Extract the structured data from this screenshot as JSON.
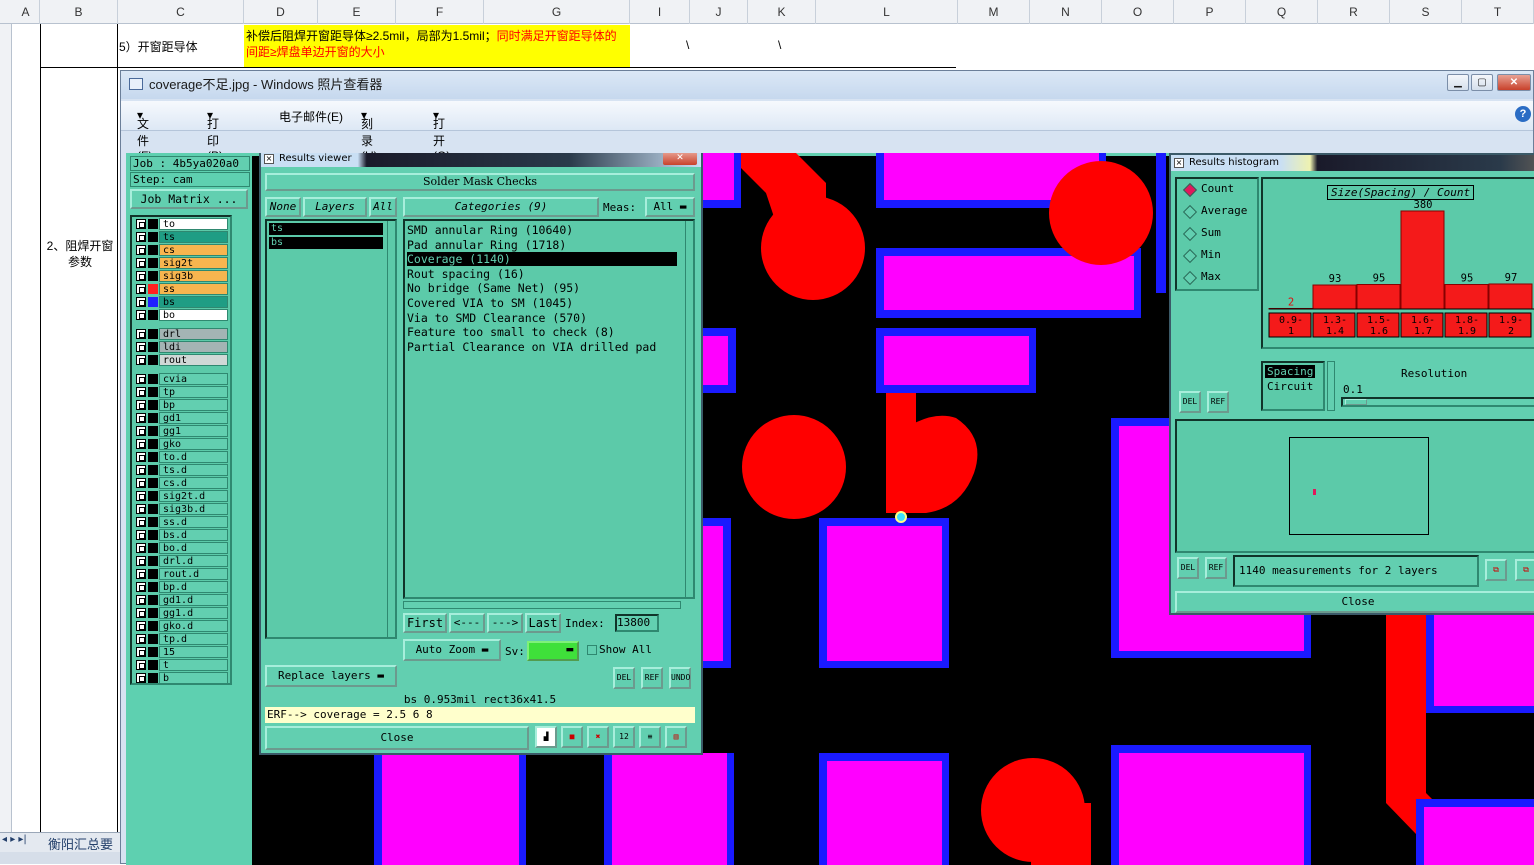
{
  "excel": {
    "columns": [
      "A",
      "B",
      "C",
      "D",
      "E",
      "F",
      "G",
      "I",
      "J",
      "K",
      "L",
      "M",
      "N",
      "O",
      "P",
      "Q",
      "R",
      "S",
      "T"
    ],
    "row_c_text": "5）开窗距导体",
    "row_d_text_black": "补偿后阻焊开窗距导体≥2.5mil，局部为1.5mil；",
    "row_d_text_red": "同时满足开窗距导体的间距≥焊盘单边开窗的大小",
    "cell_i": "\\",
    "cell_k": "\\",
    "cell_b": "2、阻焊开窗参数",
    "sheet_tab": "衡阳汇总要"
  },
  "viewer": {
    "title": "coverage不足.jpg - Windows 照片查看器",
    "menu": [
      "文件(F)",
      "打印(P)",
      "电子邮件(E)",
      "刻录(U)",
      "打开(O)"
    ],
    "colors": {
      "pad_magenta": "#ff00ff",
      "mask_blue": "#1a1aff",
      "copper_red": "#ff0000",
      "panel_teal": "#62cfb0"
    }
  },
  "job": {
    "job_label": "Job : 4b5ya020a0",
    "step_label": "Step: cam",
    "matrix_button": "Job Matrix ...",
    "layers": [
      {
        "name": "to",
        "color": "#ffffff"
      },
      {
        "name": "ts",
        "color": "#1f9d84"
      },
      {
        "name": "cs",
        "color": "#f7b54f"
      },
      {
        "name": "sig2t",
        "color": "#f7b54f"
      },
      {
        "name": "sig3b",
        "color": "#f7b54f"
      },
      {
        "name": "ss",
        "color": "#f7b54f"
      },
      {
        "name": "bs",
        "color": "#1f9d84"
      },
      {
        "name": "bo",
        "color": "#ffffff"
      },
      {
        "name": "drl",
        "color": "#a4b4b4"
      },
      {
        "name": "ldi",
        "color": "#a4b4b4"
      },
      {
        "name": "rout",
        "color": "#d0d8d6"
      },
      {
        "name": "cvia",
        "color": "#62cfb0"
      },
      {
        "name": "tp",
        "color": "#62cfb0"
      },
      {
        "name": "bp",
        "color": "#62cfb0"
      },
      {
        "name": "gd1",
        "color": "#62cfb0"
      },
      {
        "name": "gg1",
        "color": "#62cfb0"
      },
      {
        "name": "gko",
        "color": "#62cfb0"
      },
      {
        "name": "to.d",
        "color": "#62cfb0"
      },
      {
        "name": "ts.d",
        "color": "#62cfb0"
      },
      {
        "name": "cs.d",
        "color": "#62cfb0"
      },
      {
        "name": "sig2t.d",
        "color": "#62cfb0"
      },
      {
        "name": "sig3b.d",
        "color": "#62cfb0"
      },
      {
        "name": "ss.d",
        "color": "#62cfb0"
      },
      {
        "name": "bs.d",
        "color": "#62cfb0"
      },
      {
        "name": "bo.d",
        "color": "#62cfb0"
      },
      {
        "name": "drl.d",
        "color": "#62cfb0"
      },
      {
        "name": "rout.d",
        "color": "#62cfb0"
      },
      {
        "name": "bp.d",
        "color": "#62cfb0"
      },
      {
        "name": "gd1.d",
        "color": "#62cfb0"
      },
      {
        "name": "gg1.d",
        "color": "#62cfb0"
      },
      {
        "name": "gko.d",
        "color": "#62cfb0"
      },
      {
        "name": "tp.d",
        "color": "#62cfb0"
      },
      {
        "name": "15",
        "color": "#62cfb0"
      },
      {
        "name": "t",
        "color": "#62cfb0"
      },
      {
        "name": "b",
        "color": "#62cfb0"
      }
    ]
  },
  "results": {
    "title": "Results viewer",
    "heading": "Solder Mask Checks",
    "btn_none": "None",
    "btn_layers": "Layers",
    "btn_all": "All",
    "categories_label": "Categories (9)",
    "meas_label": "Meas:",
    "meas_value": "All",
    "layer_list": [
      "ts",
      "bs"
    ],
    "categories": [
      "SMD annular Ring (10640)",
      "Pad annular Ring (1718)",
      "Coverage (1140)",
      "Rout spacing (16)",
      "No bridge (Same Net) (95)",
      "Covered VIA to SM (1045)",
      "Via to SMD Clearance (570)",
      "Feature too small to check (8)",
      "Partial Clearance on VIA drilled pad"
    ],
    "selected_index_label": "Coverage (1140)",
    "nav": {
      "first": "First",
      "prev": "<---",
      "next": "--->",
      "last": "Last",
      "index_label": "Index:",
      "index_value": "13800"
    },
    "auto_zoom": "Auto Zoom",
    "sv_label": "Sv:",
    "show_all": "Show All",
    "replace_layers": "Replace layers",
    "small_btns": [
      "DEL",
      "REF",
      "UNDO"
    ],
    "info_line": "bs 0.953mil  rect36x41.5",
    "erf_line": "ERF--> coverage = 2.5 6 8",
    "close": "Close"
  },
  "histogram": {
    "title": "Results histogram",
    "modes": [
      "Count",
      "Average",
      "Sum",
      "Min",
      "Max"
    ],
    "selected_mode": "Count",
    "spacing_opt": "Spacing",
    "circuit_opt": "Circuit",
    "resolution_label": "Resolution",
    "resolution_value": "0.1",
    "summary": "1140 measurements for 2 layers",
    "close": "Close",
    "small_btns": [
      "DEL",
      "REF"
    ]
  },
  "chart_data": {
    "type": "bar",
    "title": "Size(Spacing) / Count",
    "categories": [
      "0.9-1",
      "1.3-1.4",
      "1.5-1.6",
      "1.6-1.7",
      "1.8-1.9",
      "1.9-2"
    ],
    "values": [
      2,
      93,
      95,
      380,
      95,
      97
    ]
  }
}
